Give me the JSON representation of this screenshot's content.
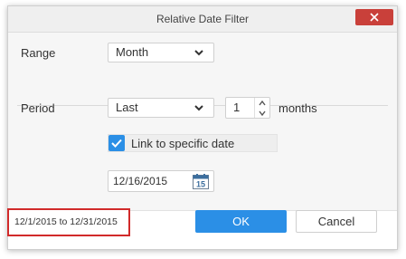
{
  "dialog": {
    "title": "Relative Date Filter",
    "close_icon": "close-icon"
  },
  "range": {
    "label": "Range",
    "selected": "Month"
  },
  "period": {
    "label": "Period",
    "selected": "Last",
    "count": "1",
    "unit_label": "months"
  },
  "link_specific_date": {
    "label": "Link to specific date",
    "checked": true
  },
  "specific_date": {
    "value": "12/16/2015",
    "calendar_day": "15"
  },
  "summary": {
    "text": "12/1/2015 to 12/31/2015"
  },
  "buttons": {
    "ok_label": "OK",
    "cancel_label": "Cancel"
  },
  "colors": {
    "accent": "#2b8fe6",
    "close": "#c9403a",
    "highlight": "#d12a2a"
  }
}
